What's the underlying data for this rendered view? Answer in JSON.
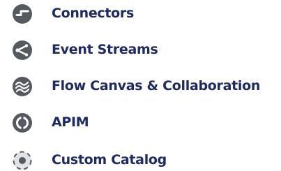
{
  "colors": {
    "label": "#1e2a66",
    "icon": "#555a61",
    "icon_light": "#e1e3e6",
    "background": "#ffffff"
  },
  "menu": {
    "items": [
      {
        "label": "Connectors",
        "icon": "connector-icon"
      },
      {
        "label": "Event Streams",
        "icon": "share-network-icon"
      },
      {
        "label": "Flow Canvas & Collaboration",
        "icon": "flow-waves-icon"
      },
      {
        "label": "APIM",
        "icon": "api-brackets-icon"
      },
      {
        "label": "Custom Catalog",
        "icon": "target-dot-icon"
      }
    ]
  }
}
